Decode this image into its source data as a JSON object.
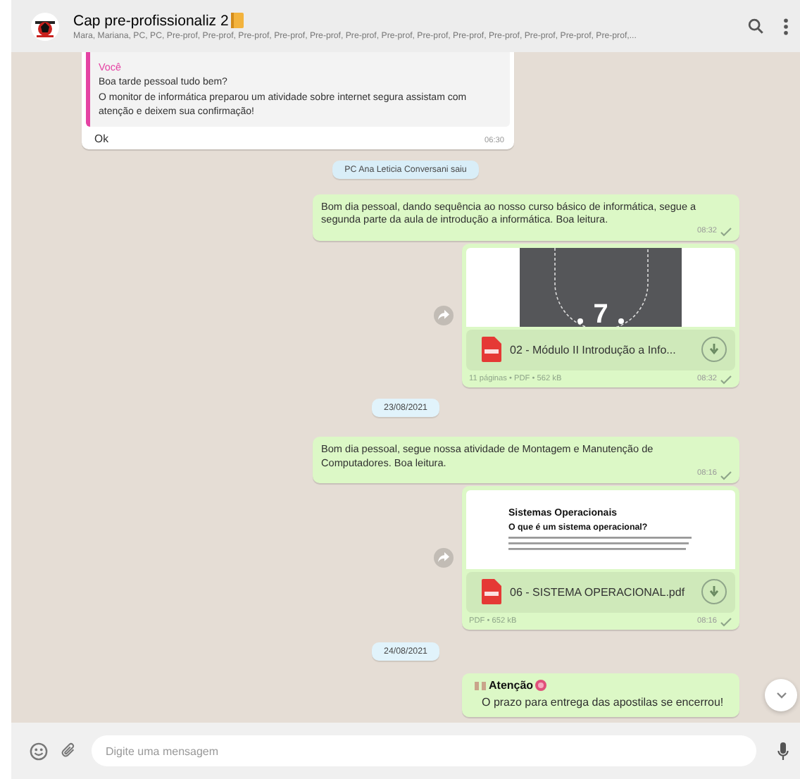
{
  "header": {
    "title": "Cap pre-profissionaliz 2",
    "subtitle": "Mara, Mariana, PC, PC, Pre-prof, Pre-prof, Pre-prof, Pre-prof, Pre-prof, Pre-prof, Pre-prof, Pre-prof, Pre-prof, Pre-prof, Pre-prof, Pre-prof, Pre-prof,..."
  },
  "messages": [
    {
      "kind": "incoming_reply",
      "quote": {
        "author": "Você",
        "lines": [
          "Boa tarde pessoal tudo bem?",
          "O monitor de informática preparou um atividade sobre internet segura assistam com atenção e deixem sua confirmação!"
        ]
      },
      "text": "Ok",
      "time": "06:30"
    },
    {
      "kind": "system",
      "text": "PC Ana Leticia Conversani saiu"
    },
    {
      "kind": "outgoing_text",
      "text": "Bom dia pessoal, dando sequência ao nosso curso básico de informática, segue a segunda parte da aula de introdução a informática. Boa leitura.",
      "time": "08:32",
      "sent": true
    },
    {
      "kind": "outgoing_document",
      "thumbnail": {
        "kind": "slide",
        "label": "7"
      },
      "file_name": "02 - Módulo II Introdução a Info...",
      "meta": "11 páginas • PDF • 562 kB",
      "time": "08:32",
      "sent": true
    },
    {
      "kind": "date",
      "text": "23/08/2021"
    },
    {
      "kind": "outgoing_text",
      "text": "Bom dia pessoal, segue nossa atividade de Montagem e Manutenção de Computadores. Boa leitura.",
      "time": "08:16",
      "sent": true
    },
    {
      "kind": "outgoing_document",
      "thumbnail": {
        "kind": "page",
        "title": "Sistemas Operacionais",
        "heading": "O que é um sistema operacional?"
      },
      "file_name": "06 - SISTEMA OPERACIONAL.pdf",
      "meta": "PDF • 652 kB",
      "time": "08:16",
      "sent": true
    },
    {
      "kind": "date",
      "text": "24/08/2021"
    },
    {
      "kind": "outgoing_partial",
      "title": "Atenção",
      "text": "O prazo para entrega das apostilas se encerrou!"
    }
  ],
  "composer": {
    "placeholder": "Digite uma mensagem"
  }
}
